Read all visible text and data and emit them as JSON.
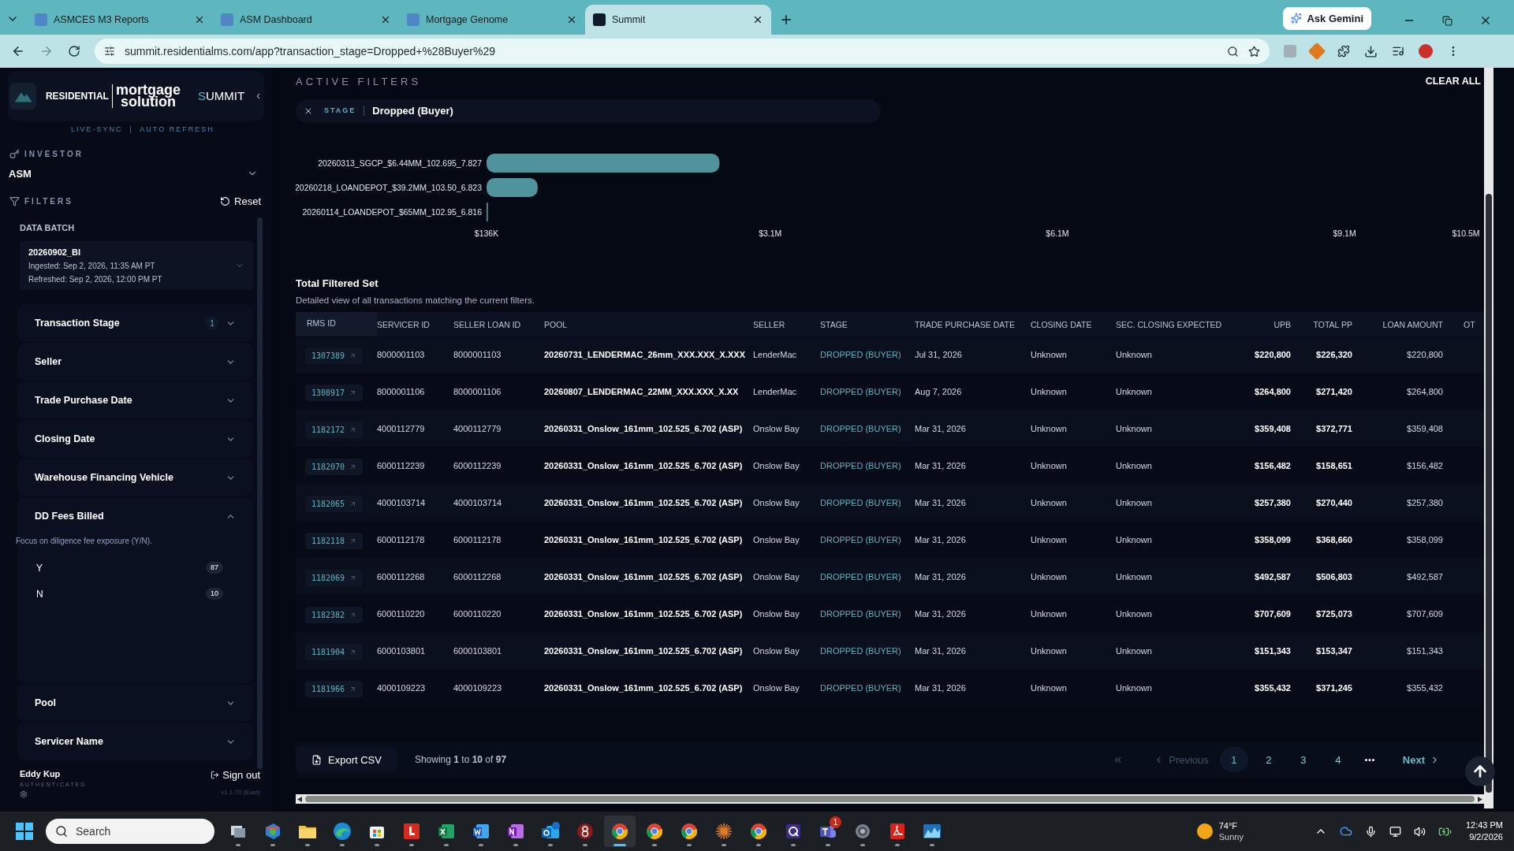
{
  "browser": {
    "tabs": [
      {
        "title": "ASMCES M3 Reports",
        "selected": false
      },
      {
        "title": "ASM Dashboard",
        "selected": false
      },
      {
        "title": "Mortgage Genome",
        "selected": false
      },
      {
        "title": "Summit",
        "selected": true
      }
    ],
    "gemini_button": "Ask Gemini",
    "url": "summit.residentialms.com/app?transaction_stage=Dropped+%28Buyer%29"
  },
  "sidebar": {
    "brand": {
      "word_left": "RESIDENTIAL",
      "word_top": "mortgage",
      "word_bottom": "solution",
      "product": "SUMMIT",
      "tagline": "LIVE-SYNC  |  AUTO REFRESH"
    },
    "investor": {
      "label": "INVESTOR",
      "value": "ASM"
    },
    "filters_label": "FILTERS",
    "reset": "Reset",
    "data_batch": {
      "label": "DATA BATCH",
      "name": "20260902_BI",
      "ingested": "Ingested: Sep 2, 2026, 11:35 AM PT",
      "refreshed": "Refreshed: Sep 2, 2026, 12:00 PM PT"
    },
    "filters": [
      {
        "title": "Transaction Stage",
        "expanded": false,
        "count": "1"
      },
      {
        "title": "Seller",
        "expanded": false
      },
      {
        "title": "Trade Purchase Date",
        "expanded": false
      },
      {
        "title": "Closing Date",
        "expanded": false
      },
      {
        "title": "Warehouse Financing Vehicle",
        "expanded": false
      },
      {
        "title": "DD Fees Billed",
        "expanded": true,
        "description": "Focus on diligence fee exposure (Y/N).",
        "options": [
          {
            "label": "Y",
            "count": "87"
          },
          {
            "label": "N",
            "count": "10"
          }
        ]
      },
      {
        "title": "Pool",
        "expanded": false
      },
      {
        "title": "Servicer Name",
        "expanded": false
      }
    ],
    "user": {
      "name": "Eddy Kup",
      "status": "AUTHENTICATED",
      "sign_out": "Sign out",
      "version": "v1.1.70 (East)"
    }
  },
  "active_filters": {
    "title": "ACTIVE FILTERS",
    "clear_all": "CLEAR ALL",
    "chips": [
      {
        "key": "STAGE",
        "value": "Dropped (Buyer)"
      }
    ]
  },
  "chart": {
    "chart_data": {
      "type": "bar",
      "orientation": "horizontal",
      "categories": [
        "20260313_SGCP_$6.44MM_102.695_7.827",
        "20260218_LOANDEPOT_$39.2MM_103.50_6.823",
        "20260114_LOANDEPOT_$65MM_102.95_6.816"
      ],
      "values": [
        2570000,
        670000,
        150000
      ],
      "xlim": [
        136000,
        10500000
      ],
      "xticks": [
        {
          "value": 136000,
          "label": "$136K"
        },
        {
          "value": 3100000,
          "label": "$3.1M"
        },
        {
          "value": 6100000,
          "label": "$6.1M"
        },
        {
          "value": 9100000,
          "label": "$9.1M"
        },
        {
          "value": 10500000,
          "label": "$10.5M"
        }
      ]
    }
  },
  "table": {
    "title": "Total Filtered Set",
    "description": "Detailed view of all transactions matching the current filters.",
    "columns": [
      {
        "label": "RMS ID",
        "kind": "link"
      },
      {
        "label": "SERVICER ID",
        "kind": "plain"
      },
      {
        "label": "SELLER LOAN ID",
        "kind": "plain"
      },
      {
        "label": "POOL",
        "kind": "bold"
      },
      {
        "label": "SELLER",
        "kind": "plain"
      },
      {
        "label": "STAGE",
        "kind": "stage"
      },
      {
        "label": "TRADE PURCHASE DATE",
        "kind": "plain"
      },
      {
        "label": "CLOSING DATE",
        "kind": "plain"
      },
      {
        "label": "SEC. CLOSING EXPECTED",
        "kind": "plain"
      },
      {
        "label": "UPB",
        "kind": "amount_bold"
      },
      {
        "label": "TOTAL PP",
        "kind": "amount_bold"
      },
      {
        "label": "LOAN AMOUNT",
        "kind": "amount"
      },
      {
        "label": "OT",
        "kind": "plain"
      }
    ],
    "rows": [
      [
        "1307389",
        "8000001103",
        "8000001103",
        "20260731_LENDERMAC_26mm_XXX.XXX_X.XXX",
        "LenderMac",
        "DROPPED (BUYER)",
        "Jul 31, 2026",
        "Unknown",
        "Unknown",
        "$220,800",
        "$226,320",
        "$220,800"
      ],
      [
        "1308917",
        "8000001106",
        "8000001106",
        "20260807_LENDERMAC_22MM_XXX.XXX_X.XX",
        "LenderMac",
        "DROPPED (BUYER)",
        "Aug 7, 2026",
        "Unknown",
        "Unknown",
        "$264,800",
        "$271,420",
        "$264,800"
      ],
      [
        "1182172",
        "4000112779",
        "4000112779",
        "20260331_Onslow_161mm_102.525_6.702 (ASP)",
        "Onslow Bay",
        "DROPPED (BUYER)",
        "Mar 31, 2026",
        "Unknown",
        "Unknown",
        "$359,408",
        "$372,771",
        "$359,408"
      ],
      [
        "1182070",
        "6000112239",
        "6000112239",
        "20260331_Onslow_161mm_102.525_6.702 (ASP)",
        "Onslow Bay",
        "DROPPED (BUYER)",
        "Mar 31, 2026",
        "Unknown",
        "Unknown",
        "$156,482",
        "$158,651",
        "$156,482"
      ],
      [
        "1182065",
        "4000103714",
        "4000103714",
        "20260331_Onslow_161mm_102.525_6.702 (ASP)",
        "Onslow Bay",
        "DROPPED (BUYER)",
        "Mar 31, 2026",
        "Unknown",
        "Unknown",
        "$257,380",
        "$270,440",
        "$257,380"
      ],
      [
        "1182118",
        "6000112178",
        "6000112178",
        "20260331_Onslow_161mm_102.525_6.702 (ASP)",
        "Onslow Bay",
        "DROPPED (BUYER)",
        "Mar 31, 2026",
        "Unknown",
        "Unknown",
        "$358,099",
        "$368,660",
        "$358,099"
      ],
      [
        "1182069",
        "6000112268",
        "6000112268",
        "20260331_Onslow_161mm_102.525_6.702 (ASP)",
        "Onslow Bay",
        "DROPPED (BUYER)",
        "Mar 31, 2026",
        "Unknown",
        "Unknown",
        "$492,587",
        "$506,803",
        "$492,587"
      ],
      [
        "1182382",
        "6000110220",
        "6000110220",
        "20260331_Onslow_161mm_102.525_6.702 (ASP)",
        "Onslow Bay",
        "DROPPED (BUYER)",
        "Mar 31, 2026",
        "Unknown",
        "Unknown",
        "$707,609",
        "$725,073",
        "$707,609"
      ],
      [
        "1181904",
        "6000103801",
        "6000103801",
        "20260331_Onslow_161mm_102.525_6.702 (ASP)",
        "Onslow Bay",
        "DROPPED (BUYER)",
        "Mar 31, 2026",
        "Unknown",
        "Unknown",
        "$151,343",
        "$153,347",
        "$151,343"
      ],
      [
        "1181966",
        "4000109223",
        "4000109223",
        "20260331_Onslow_161mm_102.525_6.702 (ASP)",
        "Onslow Bay",
        "DROPPED (BUYER)",
        "Mar 31, 2026",
        "Unknown",
        "Unknown",
        "$355,432",
        "$371,245",
        "$355,432"
      ]
    ],
    "export": "Export CSV",
    "showing": "Showing **1** to **10** of **97**",
    "pagination": [
      {
        "kind": "first",
        "disabled": true
      },
      {
        "kind": "prev",
        "label": "Previous",
        "disabled": true
      },
      {
        "kind": "page",
        "label": "1",
        "selected": true
      },
      {
        "kind": "page",
        "label": "2",
        "selected": false
      },
      {
        "kind": "page",
        "label": "3",
        "selected": false
      },
      {
        "kind": "page",
        "label": "4",
        "selected": false
      },
      {
        "kind": "ellipsis"
      },
      {
        "kind": "next",
        "label": "Next",
        "disabled": false
      }
    ]
  },
  "taskbar": {
    "search": "Search",
    "apps": [
      {
        "kind": "taskview",
        "active": false
      },
      {
        "kind": "m365",
        "active": false
      },
      {
        "kind": "folder",
        "active": false
      },
      {
        "kind": "edge",
        "active": false
      },
      {
        "kind": "store",
        "active": false
      },
      {
        "kind": "red",
        "active": false
      },
      {
        "kind": "excel",
        "active": false
      },
      {
        "kind": "word",
        "active": false
      },
      {
        "kind": "onenote",
        "active": false
      },
      {
        "kind": "outlook",
        "active": false
      },
      {
        "kind": "darkred",
        "active": false
      },
      {
        "kind": "chrome",
        "active": true
      },
      {
        "kind": "chrome",
        "active": false
      },
      {
        "kind": "chrome",
        "active": false
      },
      {
        "kind": "star",
        "active": false
      },
      {
        "kind": "chrome",
        "active": false
      },
      {
        "kind": "purple",
        "active": false
      },
      {
        "kind": "teams",
        "active": false,
        "badge": "1"
      },
      {
        "kind": "gear",
        "active": false
      },
      {
        "kind": "pdf",
        "active": false
      },
      {
        "kind": "chart",
        "active": false
      }
    ],
    "weather": {
      "temp": "74°F",
      "text": "Sunny"
    },
    "time": "12:43 PM",
    "date": "9/2/2026"
  }
}
